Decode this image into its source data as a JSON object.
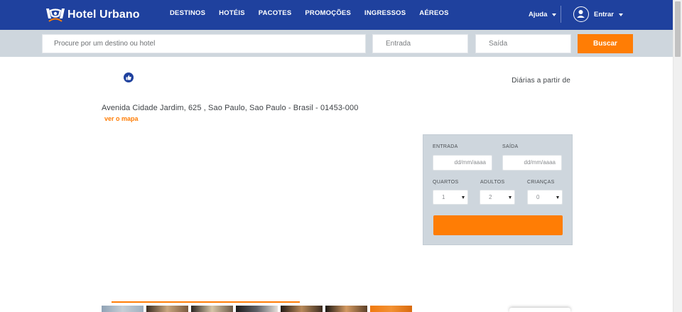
{
  "header": {
    "brand": "Hotel Urbano",
    "nav": [
      "DESTINOS",
      "HOTÉIS",
      "PACOTES",
      "PROMOÇÕES",
      "INGRESSOS",
      "AÉREOS"
    ],
    "help": "Ajuda",
    "login": "Entrar",
    "icons": {
      "logo": "hotel-urbano-logo",
      "user": "user-icon",
      "caret": "caret-down-icon"
    }
  },
  "search": {
    "destination_placeholder": "Procure por um destino ou hotel",
    "checkin_placeholder": "Entrada",
    "checkout_placeholder": "Saída",
    "button": "Buscar"
  },
  "hotel": {
    "price_label": "Diárias a partir de",
    "address": "Avenida Cidade Jardim, 625 , Sao Paulo, Sao Paulo - Brasil - 01453-000",
    "map_link": "ver o mapa"
  },
  "booking": {
    "checkin_label": "ENTRADA",
    "checkout_label": "SAÍDA",
    "checkin_placeholder": "dd/mm/aaaa",
    "checkout_placeholder": "dd/mm/aaaa",
    "rooms_label": "QUARTOS",
    "adults_label": "ADULTOS",
    "children_label": "CRIANÇAS",
    "rooms_value": "1",
    "adults_value": "2",
    "children_value": "0"
  },
  "colors": {
    "header": "#1f419e",
    "accent": "#ff7d05",
    "panel": "#ced6dd"
  }
}
